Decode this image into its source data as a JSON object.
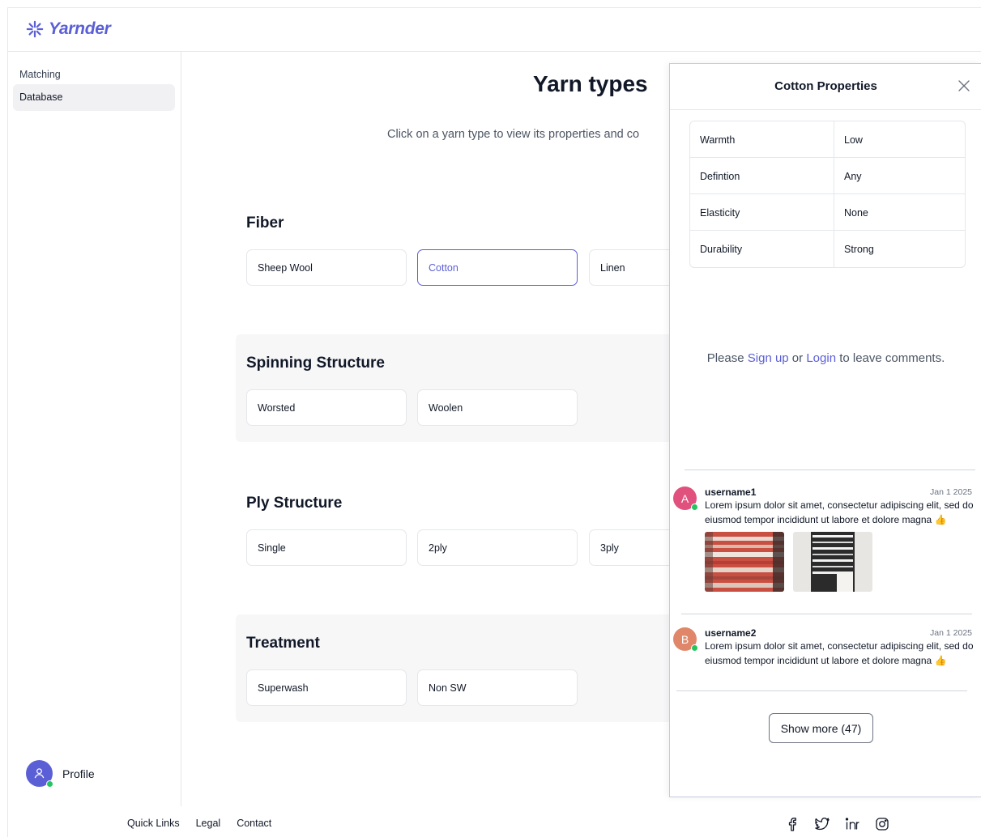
{
  "app": {
    "name": "Yarnder",
    "brand_color": "#5b5fd6"
  },
  "sidebar": {
    "items": [
      {
        "label": "Matching",
        "active": false
      },
      {
        "label": "Database",
        "active": true
      }
    ],
    "profile_label": "Profile"
  },
  "main": {
    "title": "Yarn types",
    "subtitle": "Click on a yarn type to view its properties and co",
    "sections": [
      {
        "title": "Fiber",
        "items": [
          "Sheep Wool",
          "Cotton",
          "Linen"
        ],
        "selected": "Cotton"
      },
      {
        "title": "Spinning Structure",
        "items": [
          "Worsted",
          "Woolen"
        ]
      },
      {
        "title": "Ply Structure",
        "items": [
          "Single",
          "2ply",
          "3ply"
        ]
      },
      {
        "title": "Treatment",
        "items": [
          "Superwash",
          "Non SW"
        ]
      }
    ]
  },
  "panel": {
    "title": "Cotton Properties",
    "properties": [
      {
        "key": "Warmth",
        "value": "Low"
      },
      {
        "key": "Defintion",
        "value": "Any"
      },
      {
        "key": "Elasticity",
        "value": "None"
      },
      {
        "key": "Durability",
        "value": "Strong"
      }
    ],
    "signup_prefix": "Please ",
    "signup_link": "Sign up",
    "signup_or": " or ",
    "login_link": "Login",
    "signup_suffix": " to leave comments.",
    "comments": [
      {
        "initial": "A",
        "username": "username1",
        "date": "Jan 1 2025",
        "text": "Lorem ipsum dolor sit amet, consectetur adipiscing elit, sed do eiusmod tempor incididunt ut labore et dolore magna 👍",
        "avatar_color": "#e0517d"
      },
      {
        "initial": "B",
        "username": "username2",
        "date": "Jan 1 2025",
        "text": "Lorem ipsum dolor sit amet, consectetur adipiscing elit, sed do eiusmod tempor incididunt ut labore et dolore magna 👍",
        "avatar_color": "#e0876a"
      }
    ],
    "show_more": "Show more (47)"
  },
  "footer": {
    "links": [
      "Quick Links",
      "Legal",
      "Contact"
    ],
    "social_icons": [
      "facebook-icon",
      "twitter-icon",
      "linkedin-icon",
      "instagram-icon"
    ]
  }
}
